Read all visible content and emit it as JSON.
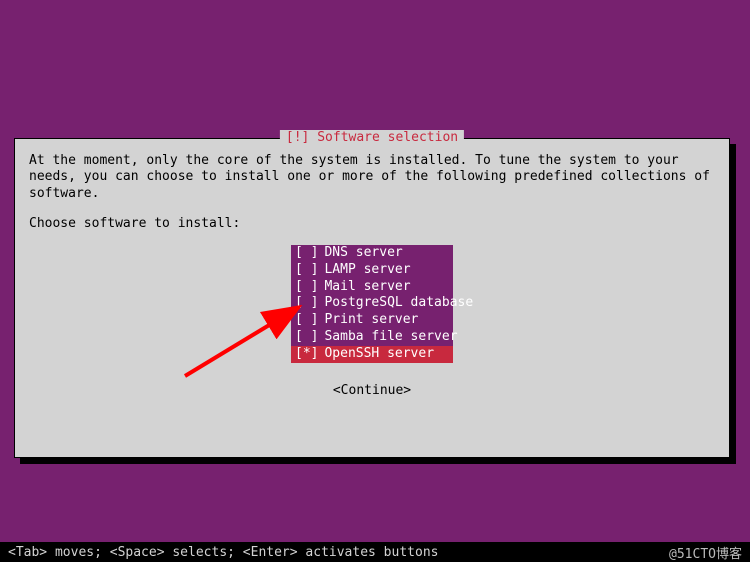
{
  "dialog": {
    "title": "[!] Software selection",
    "description": "At the moment, only the core of the system is installed. To tune the system to your needs, you can choose to install one or more of the following predefined collections of software.",
    "prompt": "Choose software to install:",
    "continue_label": "<Continue>"
  },
  "options": [
    {
      "mark": " ",
      "label": "DNS server",
      "selected": false
    },
    {
      "mark": " ",
      "label": "LAMP server",
      "selected": false
    },
    {
      "mark": " ",
      "label": "Mail server",
      "selected": false
    },
    {
      "mark": " ",
      "label": "PostgreSQL database",
      "selected": false
    },
    {
      "mark": " ",
      "label": "Print server",
      "selected": false
    },
    {
      "mark": " ",
      "label": "Samba file server",
      "selected": false
    },
    {
      "mark": "*",
      "label": "OpenSSH server",
      "selected": true
    }
  ],
  "footer": {
    "hint": "<Tab> moves; <Space> selects; <Enter> activates buttons",
    "watermark": "@51CTO博客"
  }
}
